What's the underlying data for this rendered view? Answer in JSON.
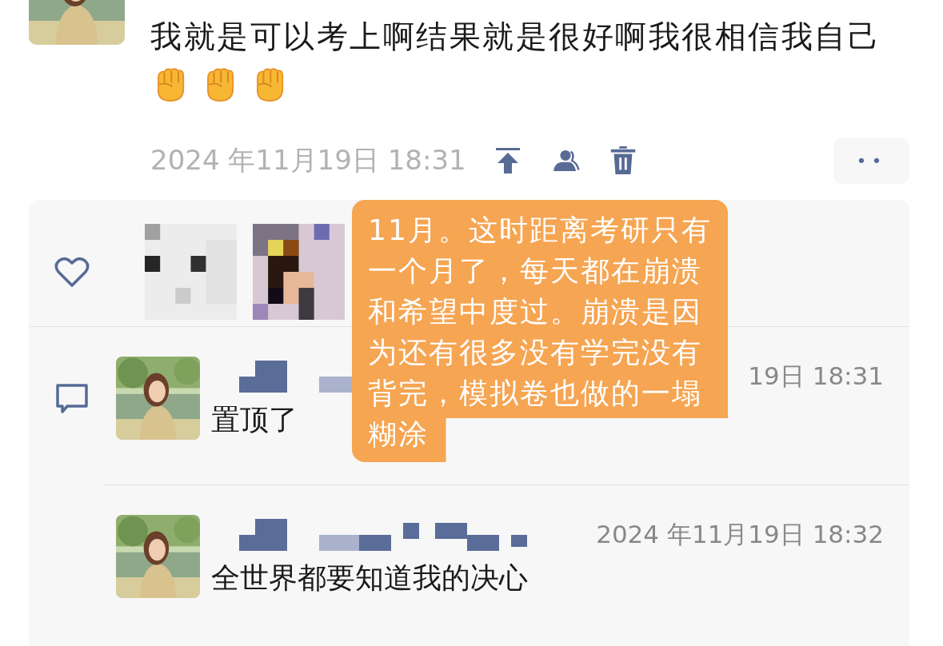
{
  "post": {
    "text": "我就是可以考上啊结果就是很好啊我很相信我自己",
    "emojis": [
      {
        "kind": "fist"
      },
      {
        "kind": "fist"
      },
      {
        "kind": "fist"
      }
    ],
    "timestamp": "2024 年11月19日 18:31",
    "more_button": "••"
  },
  "comments": [
    {
      "timestamp": "19日 18:31",
      "text": "置顶了"
    },
    {
      "timestamp": "2024 年11月19日 18:32",
      "text": "全世界都要知道我的决心"
    }
  ],
  "annotation": {
    "text": "11月。这时距离考研只有一个月了，每天都在崩溃和希望中度过。崩溃是因为还有很多没有学完没有背完，模拟卷也做的一塌糊涂"
  }
}
